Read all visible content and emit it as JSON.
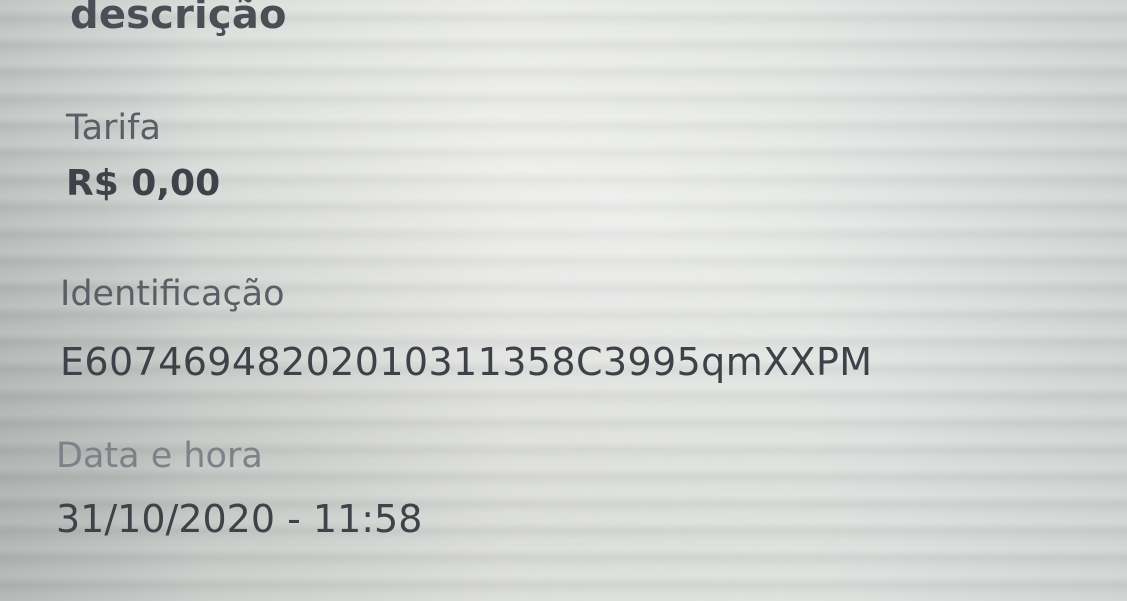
{
  "transaction_details": {
    "section_title": "descrição",
    "fare": {
      "label": "Tarifa",
      "value": "R$ 0,00"
    },
    "identification": {
      "label": "Identificação",
      "value": "E60746948202010311358C3995qmXXPM"
    },
    "datetime": {
      "label": "Data e hora",
      "value": "31/10/2020 - 11:58"
    }
  }
}
